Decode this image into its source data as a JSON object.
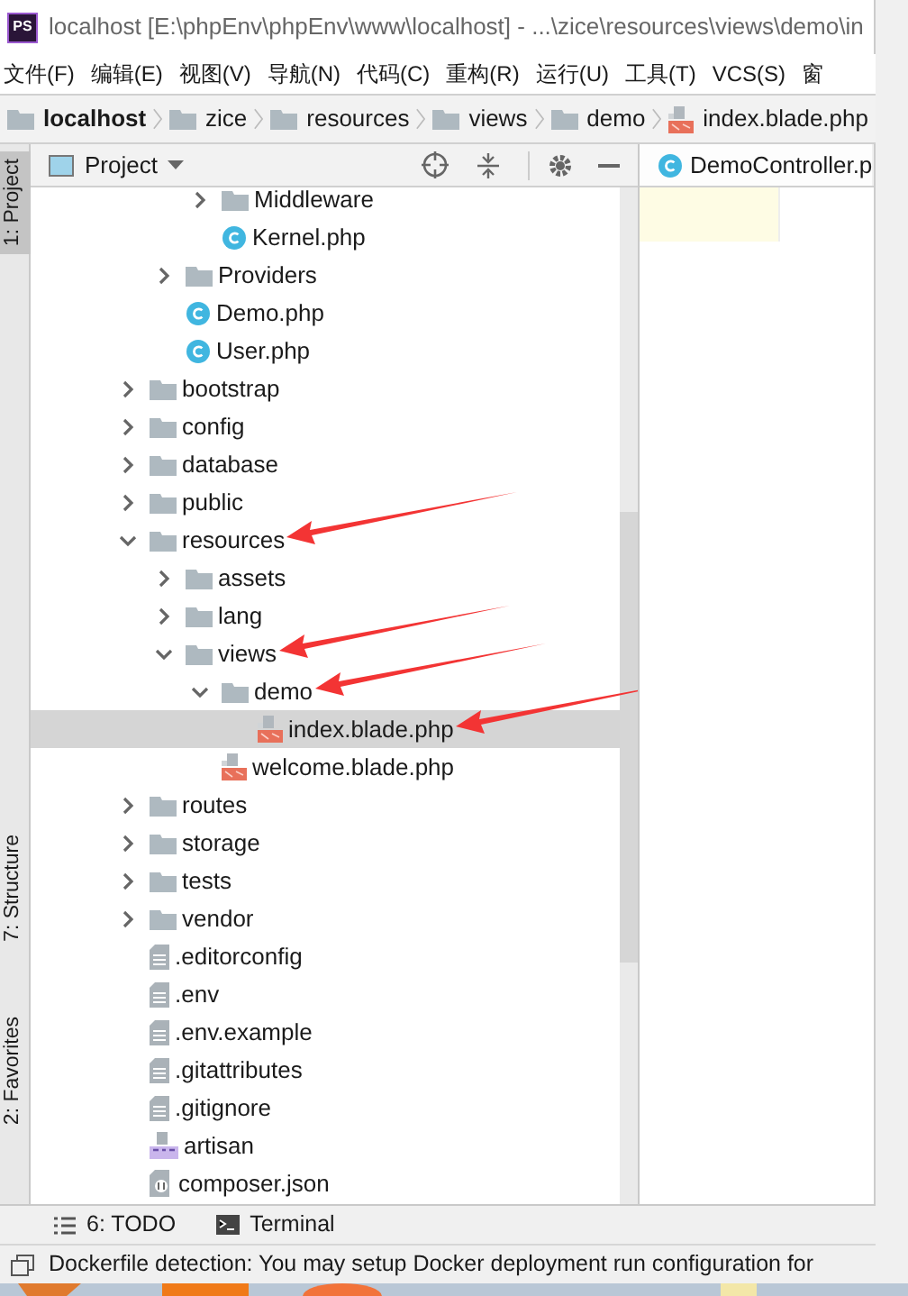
{
  "window": {
    "logo_text": "PS",
    "title": "localhost [E:\\phpEnv\\phpEnv\\www\\localhost] - ...\\zice\\resources\\views\\demo\\in"
  },
  "menu": [
    "文件(F)",
    "编辑(E)",
    "视图(V)",
    "导航(N)",
    "代码(C)",
    "重构(R)",
    "运行(U)",
    "工具(T)",
    "VCS(S)",
    "窗"
  ],
  "breadcrumbs": [
    {
      "label": "localhost",
      "kind": "folder"
    },
    {
      "label": "zice",
      "kind": "folder"
    },
    {
      "label": "resources",
      "kind": "folder"
    },
    {
      "label": "views",
      "kind": "folder"
    },
    {
      "label": "demo",
      "kind": "folder"
    },
    {
      "label": "index.blade.php",
      "kind": "blade"
    }
  ],
  "left_stripe": [
    {
      "label": "1: Project",
      "selected": true
    },
    {
      "label": "7: Structure",
      "selected": false
    },
    {
      "label": "2: Favorites",
      "selected": false
    }
  ],
  "project_panel": {
    "title": "Project",
    "tree": [
      {
        "children": [
          {
            "children": [
              {
                "label": "Middleware",
                "kind": "folder",
                "expanded": false
              },
              {
                "label": "Kernel.php",
                "kind": "php-class"
              }
            ]
          },
          {
            "label": "Providers",
            "kind": "folder",
            "expanded": false
          },
          {
            "label": "Demo.php",
            "kind": "php-class"
          },
          {
            "label": "User.php",
            "kind": "php-class"
          }
        ]
      },
      {
        "label": "bootstrap",
        "kind": "folder",
        "expanded": false
      },
      {
        "label": "config",
        "kind": "folder",
        "expanded": false
      },
      {
        "label": "database",
        "kind": "folder",
        "expanded": false
      },
      {
        "label": "public",
        "kind": "folder",
        "expanded": false
      },
      {
        "label": "resources",
        "kind": "folder",
        "expanded": true,
        "arrow": true,
        "children": [
          {
            "label": "assets",
            "kind": "folder",
            "expanded": false
          },
          {
            "label": "lang",
            "kind": "folder",
            "expanded": false
          },
          {
            "label": "views",
            "kind": "folder",
            "expanded": true,
            "arrow": true,
            "children": [
              {
                "label": "demo",
                "kind": "folder",
                "expanded": true,
                "arrow": true,
                "children": [
                  {
                    "label": "index.blade.php",
                    "kind": "blade",
                    "selected": true,
                    "arrow": true
                  }
                ]
              },
              {
                "label": "welcome.blade.php",
                "kind": "blade",
                "selected": false
              }
            ]
          }
        ]
      },
      {
        "label": "routes",
        "kind": "folder",
        "expanded": false
      },
      {
        "label": "storage",
        "kind": "folder",
        "expanded": false
      },
      {
        "label": "tests",
        "kind": "folder",
        "expanded": false
      },
      {
        "label": "vendor",
        "kind": "folder",
        "expanded": false
      },
      {
        "label": ".editorconfig",
        "kind": "text-file"
      },
      {
        "label": ".env",
        "kind": "text-file"
      },
      {
        "label": ".env.example",
        "kind": "text-file"
      },
      {
        "label": ".gitattributes",
        "kind": "text-file"
      },
      {
        "label": ".gitignore",
        "kind": "text-file"
      },
      {
        "label": "artisan",
        "kind": "php-file"
      },
      {
        "label": "composer.json",
        "kind": "json-file"
      }
    ]
  },
  "editor_tabs": [
    {
      "label": "DemoController.p",
      "selected": true
    }
  ],
  "bottom_tools": [
    {
      "label": "6: TODO",
      "kind": "todo"
    },
    {
      "label": "Terminal",
      "kind": "terminal"
    }
  ],
  "status_bar": {
    "message": "Dockerfile detection: You may setup Docker deployment run configuration for"
  }
}
